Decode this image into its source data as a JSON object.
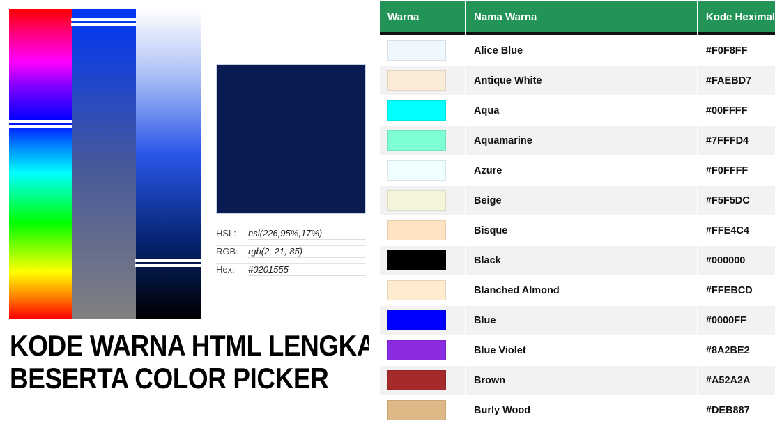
{
  "headline": {
    "line1": "Kode Warna HTML Lengkap",
    "line2": "Beserta Color Picker"
  },
  "picker": {
    "hue_strip_name": "hue-gradient",
    "saturation_strip_name": "saturation-gradient",
    "lightness_strip_name": "lightness-gradient",
    "preview_color": "#0a1b52",
    "handles": {
      "hue_position_pct": 37,
      "saturation_position_pct": 4,
      "lightness_position_pct": 82
    },
    "readouts": [
      {
        "label": "HSL:",
        "value": "hsl(226,95%,17%)"
      },
      {
        "label": "RGB:",
        "value": "rgb(2, 21, 85)"
      },
      {
        "label": "Hex:",
        "value": "#0201555"
      }
    ]
  },
  "table": {
    "accent_color": "#239457",
    "headers": [
      "Warna",
      "Nama Warna",
      "Kode Heximal",
      ""
    ],
    "rows": [
      {
        "name": "Alice Blue",
        "hex": "#F0F8FF",
        "swatch": "#F0F8FF"
      },
      {
        "name": "Antique White",
        "hex": "#FAEBD7",
        "swatch": "#FAEBD7"
      },
      {
        "name": "Aqua",
        "hex": "#00FFFF",
        "swatch": "#00FFFF"
      },
      {
        "name": "Aquamarine",
        "hex": "#7FFFD4",
        "swatch": "#7FFFD4"
      },
      {
        "name": "Azure",
        "hex": "#F0FFFF",
        "swatch": "#F0FFFF"
      },
      {
        "name": "Beige",
        "hex": "#F5F5DC",
        "swatch": "#F5F5DC"
      },
      {
        "name": "Bisque",
        "hex": "#FFE4C4",
        "swatch": "#FFE4C4"
      },
      {
        "name": "Black",
        "hex": "#000000",
        "swatch": "#000000"
      },
      {
        "name": "Blanched Almond",
        "hex": "#FFEBCD",
        "swatch": "#FFEBCD"
      },
      {
        "name": "Blue",
        "hex": "#0000FF",
        "swatch": "#0000FF"
      },
      {
        "name": "Blue Violet",
        "hex": "#8A2BE2",
        "swatch": "#8A2BE2"
      },
      {
        "name": "Brown",
        "hex": "#A52A2A",
        "swatch": "#A52A2A"
      },
      {
        "name": "Burly Wood",
        "hex": "#DEB887",
        "swatch": "#DEB887"
      }
    ]
  }
}
